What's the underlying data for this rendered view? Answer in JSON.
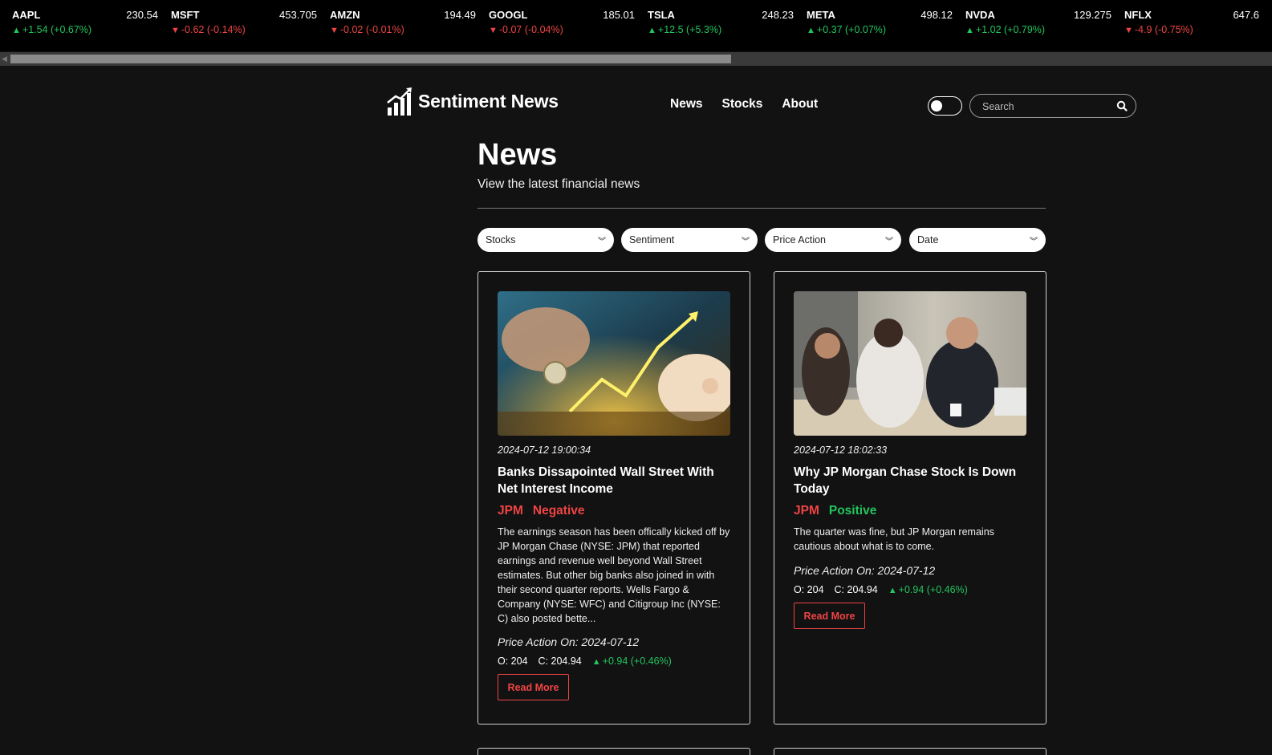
{
  "ticker": [
    {
      "symbol": "AAPL",
      "price": "230.54",
      "change": "+1.54 (+0.67%)",
      "direction": "up"
    },
    {
      "symbol": "MSFT",
      "price": "453.705",
      "change": "-0.62 (-0.14%)",
      "direction": "down"
    },
    {
      "symbol": "AMZN",
      "price": "194.49",
      "change": "-0.02 (-0.01%)",
      "direction": "down"
    },
    {
      "symbol": "GOOGL",
      "price": "185.01",
      "change": "-0.07 (-0.04%)",
      "direction": "down"
    },
    {
      "symbol": "TSLA",
      "price": "248.23",
      "change": "+12.5 (+5.3%)",
      "direction": "up"
    },
    {
      "symbol": "META",
      "price": "498.12",
      "change": "+0.37 (+0.07%)",
      "direction": "up"
    },
    {
      "symbol": "NVDA",
      "price": "129.275",
      "change": "+1.02 (+0.79%)",
      "direction": "up"
    },
    {
      "symbol": "NFLX",
      "price": "647.6",
      "change": "-4.9 (-0.75%)",
      "direction": "down"
    }
  ],
  "header": {
    "brand": "Sentiment News",
    "nav": [
      "News",
      "Stocks",
      "About"
    ],
    "search_placeholder": "Search"
  },
  "page": {
    "title": "News",
    "subtitle": "View the latest financial news"
  },
  "filters": [
    "Stocks",
    "Sentiment",
    "Price Action",
    "Date"
  ],
  "articles": [
    {
      "date": "2024-07-12 19:00:34",
      "title": "Banks Dissapointed Wall Street With Net Interest Income",
      "ticker": "JPM",
      "sentiment": "Negative",
      "summary": "The earnings season has been offically kicked off by JP Morgan Chase (NYSE: JPM) that reported earnings and revenue well beyond Wall Street estimates. But other big banks also joined in with their second quarter reports. Wells Fargo & Company (NYSE: WFC) and Citigroup Inc (NYSE: C) also posted bette...",
      "price_action_label": "Price Action On: 2024-07-12",
      "open": "O: 204",
      "close": "C: 204.94",
      "change": "+0.94 (+0.46%)",
      "read_more": "Read More"
    },
    {
      "date": "2024-07-12 18:02:33",
      "title": "Why JP Morgan Chase Stock Is Down Today",
      "ticker": "JPM",
      "sentiment": "Positive",
      "summary": "The quarter was fine, but JP Morgan remains cautious about what is to come.",
      "price_action_label": "Price Action On: 2024-07-12",
      "open": "O: 204",
      "close": "C: 204.94",
      "change": "+0.94 (+0.46%)",
      "read_more": "Read More"
    }
  ],
  "colors": {
    "up": "#22c55e",
    "down": "#ef4444",
    "background": "#121212"
  }
}
